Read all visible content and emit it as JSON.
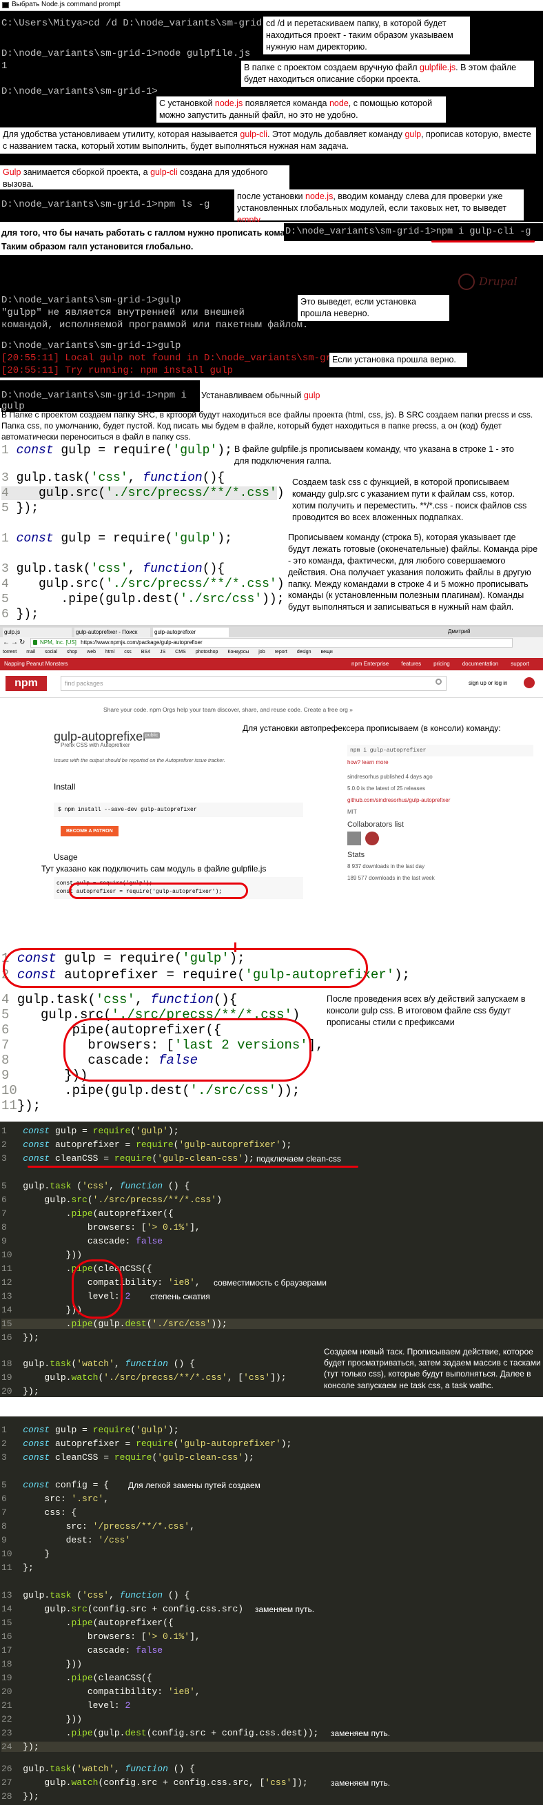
{
  "window": {
    "title": "Выбрать Node.js command prompt",
    "icon": "terminal-icon"
  },
  "cmd": {
    "l1": "C:\\Users\\Mitya>cd /d D:\\node_variants\\sm-grid-1",
    "l2": "D:\\node_variants\\sm-grid-1>node gulpfile.js",
    "l3": "1",
    "l4": "D:\\node_variants\\sm-grid-1>",
    "l5": "D:\\node_variants\\sm-grid-1>npm ls -g",
    "l6": "для того, что бы начать работать с галлом нужно прописать команду:",
    "l6b": "D:\\node_variants\\sm-grid-1>npm i gulp-cli -g",
    "l7": "Таким образом галп установится глобально.",
    "l8": "D:\\node_variants\\sm-grid-1>gulp",
    "l9": "\"gulpp\" не является внутренней или внешней",
    "l10": "командой, исполняемой программой или пакетным файлом.",
    "l11": "D:\\node_variants\\sm-grid-1>gulp",
    "l12": "[20:55:11] Local gulp not found in D:\\node_variants\\sm-grid-1",
    "l13": "[20:55:11] Try running: npm install gulp",
    "l14": "D:\\node_variants\\sm-grid-1>npm i gulp"
  },
  "notes": {
    "n1": "cd /d и перетаскиваем папку, в которой будет находиться проект - таким образом указываем нужную нам директорию.",
    "n2a": "В папке с проектом создаем вручную файл ",
    "n2b": "gulpfile.js",
    "n2c": ". В этом файле будет находиться описание сборки проекта.",
    "n3a": "С установкой ",
    "n3b": "node.js",
    "n3c": " появляется команда ",
    "n3d": "node",
    "n3e": ", с помощью которой можно запустить данный файл, но это не удобно.",
    "n4a": "Для удобства установливаем утилиту, которая называется ",
    "n4b": "gulp-cli",
    "n4c": ". Этот модуль добавляет команду ",
    "n4d": "gulp",
    "n4e": ", прописав которую, вместе с названием таска, который хотим выполнить, будет выполняться нужная нам задача.",
    "n5a": "Gulp",
    "n5b": " занимается сборкой проекта, а ",
    "n5c": "gulp-cli",
    "n5d": " создана для удобного вызова.",
    "n6a": "после установки ",
    "n6b": "node.js",
    "n6c": ", вводим команду слева для проверки уже установленных глобальных модулей, если таковых нет, то выведет ",
    "n6d": "empty",
    "n6e": ".",
    "n7": "Это выведет, если установка прошла неверно.",
    "n8": "Если установка прошла верно.",
    "n9a": "Устанавливаем обычный ",
    "n9b": "gulp",
    "watermark": "Drupal"
  },
  "section2": {
    "intro": "В Папке с проектом создаем папку SRC, в кртоорй будут находиться все файлы проекта (html, css, js). В SRC создаем папки precss и css. Папка css, по умолчанию, будет пустой. Код писать мы будем в файле, который будет находиться в папке precss, а он (код) будет автоматически переноситься в файл в папку css.",
    "noteA": "В файле gulpfile.js прописываем команду, что указана в строке 1 - это для подключения галпа.",
    "noteB": "Создаем task css с функцией, в которой прописываем команду gulp.src с указанием пути к файлам css, котор. хотим получить и переместить. **/*.css - поиск файлов css проводится во всех вложенных подпапках.",
    "noteC": "Прописываем команду (строка 5), которая указывает где будут лежать готовые (оконечательные) файлы. Команда pipe - это команда, фактически, для любого совершаемого действия. Она получает указания положить файлы в другую папку. Между командами в строке 4 и 5 можно прописывать команды (к установленным полезным плагинам). Команды будут выполняться и записываться в нужный нам файл."
  },
  "browser": {
    "tabs": [
      "gulp.js",
      "gulp-autoprefixer - Поиск",
      "gulp-autoprefixer"
    ],
    "url": "https://www.npmjs.com/package/gulp-autoprefixer",
    "secure": "NPM, Inc. [US]",
    "bookmarks": [
      "torrent",
      "mail",
      "social",
      "shop",
      "web",
      "html",
      "css",
      "BS4",
      "JS",
      "CMS",
      "photoshop",
      "Конкурсы",
      "job",
      "report",
      "design",
      "вещи"
    ],
    "user": "Дмитрий",
    "npm_top": "Napping Peanut Monsters",
    "npm_nav": [
      "npm Enterprise",
      "features",
      "pricing",
      "documentation",
      "support"
    ],
    "search_placeholder": "find packages",
    "signup": "sign up or log in",
    "banner": "Share your code. npm Orgs help your team discover, share, and reuse code. Create a free org »",
    "pkg": "gulp-autoprefixer",
    "badge": "public",
    "desc": "Prefix CSS with Autoprefixer",
    "issues": "Issues with the output should be reported on the Autoprefixer issue tracker.",
    "install_h": "Install",
    "install_cmd": "$ npm install --save-dev gulp-autoprefixer",
    "patron": "BECOME A PATRON",
    "usage_h": "Usage",
    "usage1": "const gulp = require('gulp');",
    "usage2": "const autoprefixer = require('gulp-autoprefixer');",
    "side_cmd": "npm i gulp-autoprefixer",
    "how": "how? learn more",
    "author": "sindresorhus published 4 days ago",
    "version": "5.0.0 is the latest of 25 releases",
    "repo": "github.com/sindresorhus/gulp-autoprefixer",
    "license": "MIT",
    "collab": "Collaborators list",
    "stats_h": "Stats",
    "stat1": "8 937 downloads in the last day",
    "stat2": "189 577 downloads in the last week",
    "note_install": "Для установки автопрефексера прописываем (в консоли) команду:",
    "note_usage": "Тут указано как подключить сам модуль в файле gulpfile.js"
  },
  "section3": {
    "note": "После проведения всех в/у действий запускаем в консоли gulp css. В итоговом файле css будут прописаны стили с префиксами"
  },
  "section4": {
    "note_clean": "подключаем clean-css",
    "note_compat": "совместимость с браузерами",
    "note_level": "степень сжатия",
    "note_watch": "Создаем новый таск. Прописываем действие, которое будет просматриваться, затем задаем массив с тасками (тут только css), которые будут выполняться. Далее в консоле запускаем не task css, а task wathc."
  },
  "section5": {
    "note_config": "Для легкой замены путей создаем",
    "note_src": "заменяем путь.",
    "note_dest": "заменяем путь.",
    "note_watch": "заменяем путь."
  }
}
